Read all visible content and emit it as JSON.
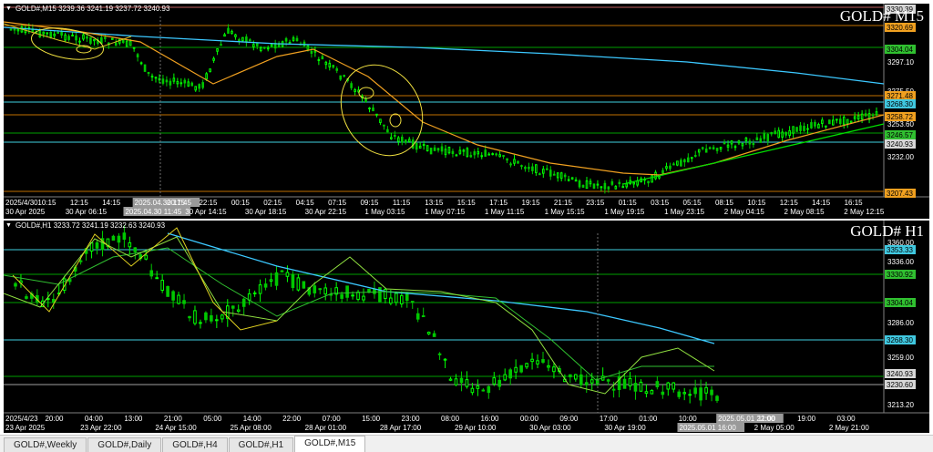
{
  "pane_m15": {
    "header": "GOLD#,M15  3239.36 3241.19 3237.72 3240.93",
    "title": "GOLD# M15",
    "price_scale": [
      "3330.39",
      "3320.69",
      "3304.04",
      "3297.10",
      "3275.50",
      "3271.48",
      "3268.30",
      "3258.72",
      "3253.60",
      "3246.57",
      "3240.93",
      "3232.00",
      "3207.43"
    ],
    "price_tags": [
      {
        "label": "3330.39",
        "bg": "#d8d8d8",
        "fg": "#000000"
      },
      {
        "label": "3320.69",
        "bg": "#f0a020",
        "fg": "#000000"
      },
      {
        "label": "3304.04",
        "bg": "#30c030",
        "fg": "#000000"
      },
      {
        "label": "3271.48",
        "bg": "#f0a020",
        "fg": "#000000"
      },
      {
        "label": "3268.30",
        "bg": "#40c8e0",
        "fg": "#000000"
      },
      {
        "label": "3258.72",
        "bg": "#f0a020",
        "fg": "#000000"
      },
      {
        "label": "3246.57",
        "bg": "#30c030",
        "fg": "#000000"
      },
      {
        "label": "3240.93",
        "bg": "#d8d8d8",
        "fg": "#000000"
      },
      {
        "label": "3207.43",
        "bg": "#f0a020",
        "fg": "#000000"
      }
    ],
    "time_row1": [
      "2025/4/30",
      "10:15",
      "12:15",
      "14:15",
      "2025.04.30 17:45",
      "20:15",
      "22:15",
      "00:15",
      "02:15",
      "04:15",
      "07:15",
      "09:15",
      "11:15",
      "13:15",
      "15:15",
      "17:15",
      "19:15",
      "21:15",
      "23:15",
      "01:15",
      "03:15",
      "05:15",
      "08:15",
      "10:15",
      "12:15",
      "14:15",
      "16:15"
    ],
    "time_row2": [
      "30 Apr 2025",
      "30 Apr 06:15",
      "2025.04.30 11:45",
      "30 Apr 14:15",
      "30 Apr 18:15",
      "30 Apr 22:15",
      "1 May 03:15",
      "1 May 07:15",
      "1 May 11:15",
      "1 May 15:15",
      "1 May 19:15",
      "1 May 23:15",
      "2 May 04:15",
      "2 May 08:15",
      "2 May 12:15"
    ]
  },
  "pane_h1": {
    "header": "GOLD#,H1  3233.72 3241.19 3232.63 3240.93",
    "title": "GOLD# H1",
    "price_scale": [
      "3360.00",
      "3353.33",
      "3336.00",
      "3330.92",
      "3304.04",
      "3286.00",
      "3268.30",
      "3259.00",
      "3240.93",
      "3230.60",
      "3213.20"
    ],
    "price_tags": [
      {
        "label": "3353.33",
        "bg": "#40c8e0",
        "fg": "#000000"
      },
      {
        "label": "3330.92",
        "bg": "#30c030",
        "fg": "#000000"
      },
      {
        "label": "3304.04",
        "bg": "#30c030",
        "fg": "#000000"
      },
      {
        "label": "3268.30",
        "bg": "#40c8e0",
        "fg": "#000000"
      },
      {
        "label": "3240.93",
        "bg": "#d8d8d8",
        "fg": "#000000"
      },
      {
        "label": "3230.60",
        "bg": "#d8d8d8",
        "fg": "#000000"
      }
    ],
    "time_row1": [
      "2025/4/23",
      "20:00",
      "04:00",
      "13:00",
      "21:00",
      "05:00",
      "14:00",
      "22:00",
      "07:00",
      "15:00",
      "23:00",
      "08:00",
      "16:00",
      "00:00",
      "09:00",
      "17:00",
      "01:00",
      "10:00",
      "2025.05.01 22:00",
      "11:00",
      "19:00",
      "03:00"
    ],
    "time_row2": [
      "23 Apr 2025",
      "23 Apr 22:00",
      "24 Apr 15:00",
      "25 Apr 08:00",
      "28 Apr 01:00",
      "28 Apr 17:00",
      "29 Apr 10:00",
      "30 Apr 03:00",
      "30 Apr 19:00",
      "2025.05.01 16:00",
      "2 May 05:00",
      "2 May 21:00"
    ]
  },
  "tabs": [
    "GOLD#,Weekly",
    "GOLD#,Daily",
    "GOLD#,H4",
    "GOLD#,H1",
    "GOLD#,M15"
  ],
  "active_tab": "GOLD#,M15",
  "colors": {
    "background": "#000000",
    "bull_candle": "#00ff00",
    "bear_candle": "#00c800",
    "ma_slow": "#3cc8ff",
    "ma_orange": "#f0a020",
    "trendline": "#00dd00",
    "ellipse": "#f0e040",
    "h_line_green": "#00a000",
    "h_line_cyan": "#40d0e0",
    "h_line_orange": "#c07000"
  }
}
